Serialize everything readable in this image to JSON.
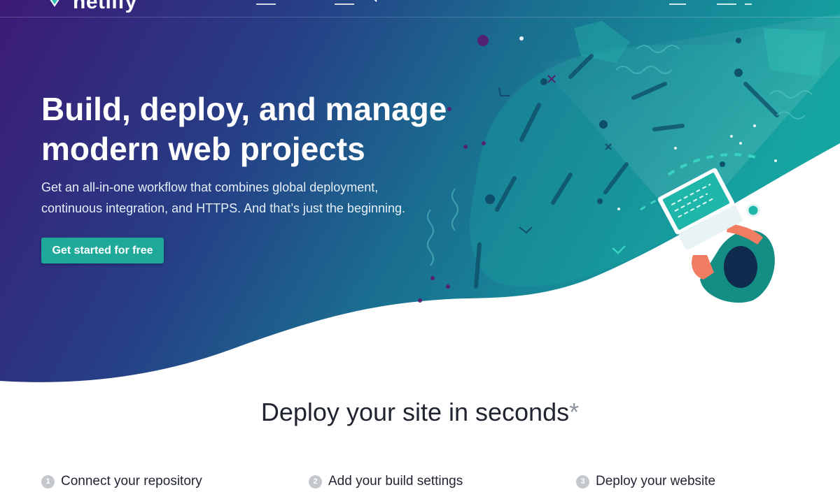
{
  "nav": {
    "logo_text": "netlify"
  },
  "hero": {
    "title_line1": "Build, deploy, and manage",
    "title_line2": "modern web projects",
    "subtitle_line1": "Get an all-in-one workflow that combines global deployment,",
    "subtitle_line2": "continuous integration, and HTTPS. And that’s just the beginning.",
    "cta_label": "Get started for free"
  },
  "deploy": {
    "title": "Deploy your site in seconds",
    "asterisk": "*",
    "steps": [
      {
        "number": "1",
        "label": "Connect your repository"
      },
      {
        "number": "2",
        "label": "Add your build settings"
      },
      {
        "number": "3",
        "label": "Deploy your website"
      }
    ]
  },
  "colors": {
    "gradient_start": "#3d1a77",
    "gradient_mid": "#1f5a8a",
    "gradient_end": "#14a3a0",
    "accent": "#1fa99b",
    "heading": "#1f2430"
  }
}
